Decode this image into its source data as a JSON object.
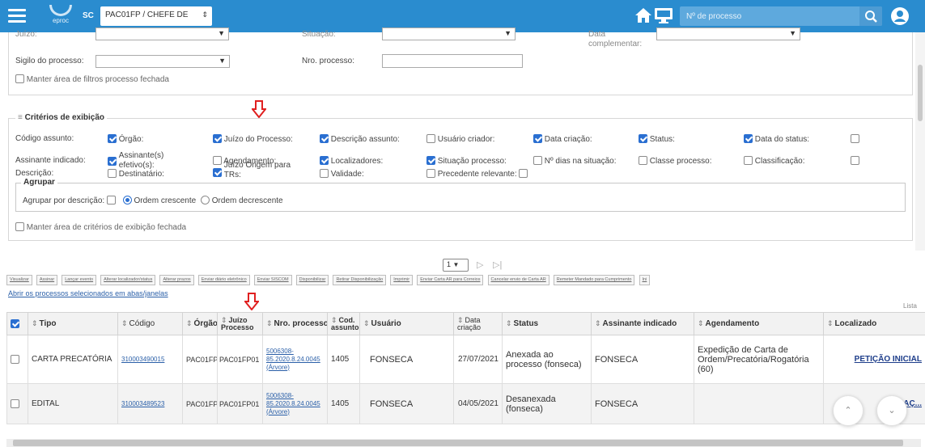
{
  "header": {
    "logo_text": "eproc",
    "state": "SC",
    "profile_select": "PAC01FP / CHEFE DE",
    "search_placeholder": "Nº de processo",
    "colors": {
      "bar": "#2a8ccf"
    }
  },
  "filters": {
    "cut_labels": [
      "Juízo:",
      "Situação:",
      "Data complementar:"
    ],
    "sigilo_label": "Sigilo do processo:",
    "sigilo_value": "",
    "nro_label": "Nro. processo:",
    "nro_value": "",
    "keep_closed_label": "Manter área de filtros processo fechada"
  },
  "criteria": {
    "title": "Critérios de exibição",
    "title_prefix": "≡",
    "row1": [
      {
        "label": "Código assunto:",
        "checked": null
      },
      {
        "label": "Órgão:",
        "checked": true
      },
      {
        "label": "Juízo do Processo:",
        "checked": true
      },
      {
        "label": "Descrição assunto:",
        "checked": true
      },
      {
        "label": "Usuário criador:",
        "checked": false
      },
      {
        "label": "Data criação:",
        "checked": true
      },
      {
        "label": "Status:",
        "checked": true
      },
      {
        "label": "Data do status:",
        "checked": true
      },
      {
        "label": "",
        "checked": false
      }
    ],
    "row2": [
      {
        "label": "Assinante indicado:",
        "checked": null
      },
      {
        "label": "Assinante(s) efetivo(s):",
        "checked": true
      },
      {
        "label": "Agendamento:",
        "checked": false
      },
      {
        "label": "Localizadores:",
        "checked": true
      },
      {
        "label": "Situação processo:",
        "checked": true
      },
      {
        "label": "Nº dias na situação:",
        "checked": false
      },
      {
        "label": "Classe processo:",
        "checked": false
      },
      {
        "label": "Classificação:",
        "checked": false
      },
      {
        "label": "",
        "checked": false
      }
    ],
    "row3": [
      {
        "label": "Descrição:",
        "checked": null
      },
      {
        "label": "Destinatário:",
        "checked": false
      },
      {
        "label": "Juízo Origem para TRs:",
        "checked": true
      },
      {
        "label": "Validade:",
        "checked": false
      },
      {
        "label": "Precedente relevante:",
        "checked": false
      }
    ],
    "group": {
      "title": "Agrupar",
      "by_description": "Agrupar por descrição:",
      "asc": "Ordem crescente",
      "desc": "Ordem decrescente"
    },
    "keep_closed_label": "Manter área de critérios de exibição fechada"
  },
  "pager": {
    "page": "1",
    "next": "▷",
    "last": "▷|"
  },
  "actions": [
    "Visualizar",
    "Assinar",
    "Lançar evento",
    "Alterar localizador/status",
    "Alterar prazos",
    "Enviar diário eletrônico",
    "Enviar SISCOM",
    "Disponibilizar",
    "Retirar Disponibilização",
    "Imprimir",
    "Enviar Carta AR para Correios",
    "Cancelar envio de Carta AR",
    "Remeter Mandado para Cumprimento",
    "Ini"
  ],
  "open_link": "Abrir os processos selecionados em abas/janelas",
  "lista_label": "Lista",
  "table": {
    "columns": [
      "Tipo",
      "Código",
      "Órgão",
      "Juízo Processo",
      "Nro. processo",
      "Cod. assunto",
      "Usuário",
      "Data criação",
      "Status",
      "Assinante indicado",
      "Agendamento",
      "Localizado"
    ],
    "rows": [
      {
        "tipo": "CARTA PRECATÓRIA",
        "codigo": "310003490015",
        "orgao": "PAC01FP",
        "juizo": "PAC01FP01",
        "nro_line1": "5006308-",
        "nro_line2": "85.2020.8.24.0045",
        "nro_tree": "(Árvore)",
        "cod_assunto": "1405",
        "usuario": "FONSECA",
        "data": "27/07/2021",
        "status": "Anexada ao processo (fonseca)",
        "assinante": "FONSECA",
        "agendamento": "Expedição de Carta de Ordem/Precatória/Rogatória (60)",
        "localizador": "PETIÇÃO INICIAL"
      },
      {
        "tipo": "EDITAL",
        "codigo": "310003489523",
        "orgao": "PAC01FP",
        "juizo": "PAC01FP01",
        "nro_line1": "5006308-",
        "nro_line2": "85.2020.8.24.0045",
        "nro_tree": "(Árvore)",
        "cod_assunto": "1405",
        "usuario": "FONSECA",
        "data": "04/05/2021",
        "status": "Desanexada (fonseca)",
        "assinante": "FONSECA",
        "agendamento": "",
        "localizador": "AÇ..."
      }
    ]
  },
  "icons": [
    "hamburger-icon",
    "home-icon",
    "monitor-icon",
    "search-icon",
    "user-icon",
    "red-down-arrow-icon",
    "chevron-up-icon",
    "chevron-down-icon"
  ]
}
